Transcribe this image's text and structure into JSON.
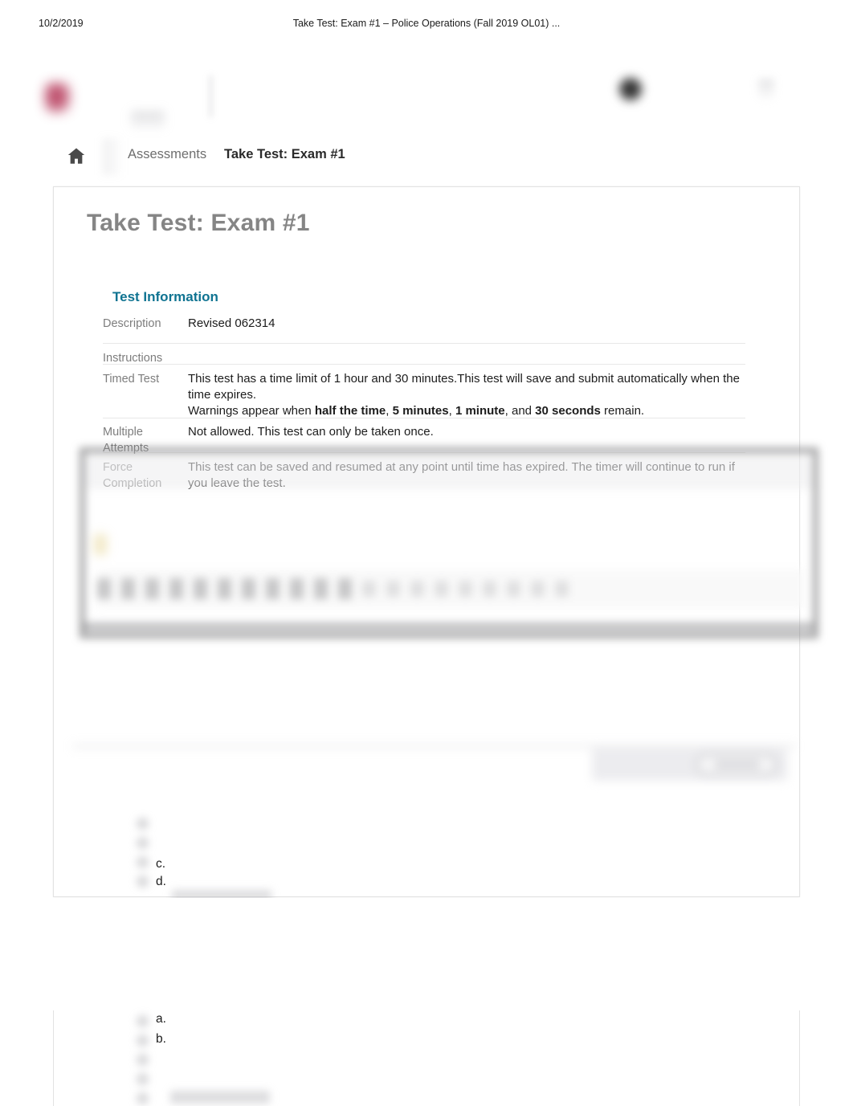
{
  "print_header": {
    "date": "10/2/2019",
    "title": "Take Test: Exam #1 – Police Operations (Fall 2019 OL01) ..."
  },
  "chrome": {
    "logo_icon": "institution-logo-icon",
    "avatar_icon": "user-avatar-icon",
    "menu_icon": "menu-icon"
  },
  "breadcrumb": {
    "home_icon": "home-icon",
    "parent": "Assessments",
    "current": "Take Test: Exam #1"
  },
  "page": {
    "title": "Take Test: Exam #1"
  },
  "test_information": {
    "heading": "Test Information",
    "rows": [
      {
        "label": "Description",
        "value": "Revised 062314"
      },
      {
        "label": "Instructions",
        "value": ""
      },
      {
        "label": "Timed Test",
        "line1": "This test has a time limit of 1 hour and 30 minutes.This test will save and submit automatically when the time expires.",
        "line2_prefix": "Warnings appear when ",
        "bold1": "half the time",
        "sep1": ", ",
        "bold2": "5 minutes",
        "sep2": ", ",
        "bold3": "1 minute",
        "sep3": ", and ",
        "bold4": "30 seconds",
        "line2_suffix": " remain."
      },
      {
        "label": "Multiple Attempts",
        "value": "Not allowed. This test can only be taken once."
      },
      {
        "label": "Force Completion",
        "value": "This test can be saved and resumed at any point until time has expired. The timer will continue to run if you leave the test."
      }
    ]
  },
  "question_options": {
    "block1": [
      "c.",
      "d."
    ],
    "block2": [
      "a.",
      "b."
    ]
  },
  "colors": {
    "heading_teal": "#0f7391",
    "title_gray": "#858585",
    "label_gray": "#7d7d7d",
    "body_dark": "#1c1c1c",
    "card_border": "#e2e2e2"
  }
}
